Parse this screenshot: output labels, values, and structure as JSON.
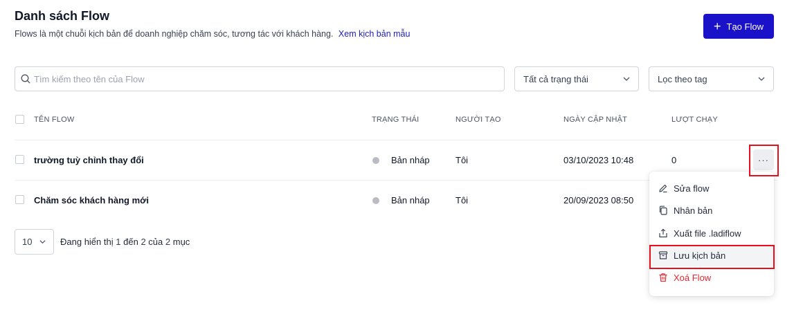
{
  "header": {
    "title": "Danh sách Flow",
    "subtitle": "Flows là một chuỗi kịch bản để doanh nghiệp chăm sóc, tương tác với khách hàng.",
    "sample_link": "Xem kịch bản mẫu",
    "create_button": "Tạo Flow"
  },
  "filters": {
    "search_placeholder": "Tìm kiếm theo tên của Flow",
    "status_select": "Tất cả trạng thái",
    "tag_select": "Lọc theo tag"
  },
  "table": {
    "columns": [
      "TÊN FLOW",
      "TRẠNG THÁI",
      "NGƯỜI TẠO",
      "NGÀY CẬP NHẬT",
      "LƯỢT CHẠY"
    ],
    "rows": [
      {
        "name": "trường tuỳ chỉnh thay đổi",
        "status": "Bản nháp",
        "creator": "Tôi",
        "updated": "03/10/2023 10:48",
        "runs": "0"
      },
      {
        "name": "Chăm sóc khách hàng mới",
        "status": "Bản nháp",
        "creator": "Tôi",
        "updated": "20/09/2023 08:50",
        "runs": ""
      }
    ],
    "more_label": "···"
  },
  "context_menu": {
    "items": [
      {
        "label": "Sửa flow",
        "icon": "edit-icon"
      },
      {
        "label": "Nhân bản",
        "icon": "copy-icon"
      },
      {
        "label": "Xuất file .ladiflow",
        "icon": "export-icon"
      },
      {
        "label": "Lưu kịch bản",
        "icon": "archive-icon",
        "active": true
      },
      {
        "label": "Xoá Flow",
        "icon": "trash-icon",
        "danger": true
      }
    ]
  },
  "pagination": {
    "per_page": "10",
    "info_prefix": "Đang hiển thị",
    "from": "1",
    "to_word": "đến",
    "to": "2",
    "of_word": "của",
    "total": "2",
    "suffix": "mục"
  },
  "colors": {
    "primary": "#1a12c9",
    "link": "#1d1db8",
    "danger": "#e3262f",
    "highlight": "#ea0d1a",
    "status_draft": "#b9bcc2"
  }
}
